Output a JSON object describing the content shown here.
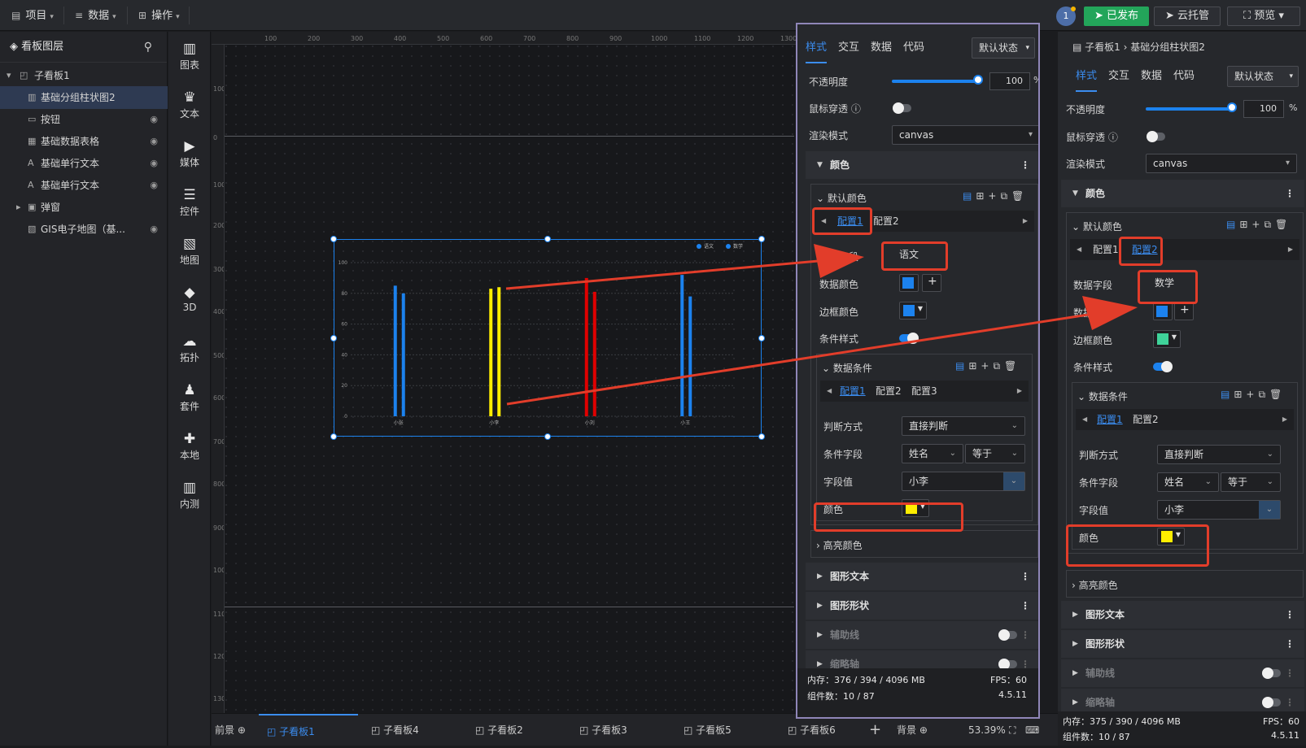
{
  "topbar": {
    "menu_project": "项目",
    "menu_data": "数据",
    "menu_ops": "操作",
    "avatar_count": "1",
    "publish_label": "已发布",
    "cloud_label": "云托管",
    "preview_label": "预览",
    "publish_color": "#23a55a"
  },
  "layers": {
    "title": "看板图层",
    "items": [
      {
        "label": "子看板1",
        "icon": "board-icon"
      },
      {
        "label": "基础分组柱状图2",
        "icon": "bar-chart-icon"
      },
      {
        "label": "按钮",
        "icon": "button-icon"
      },
      {
        "label": "基础数据表格",
        "icon": "table-icon"
      },
      {
        "label": "基础单行文本",
        "icon": "text-icon"
      },
      {
        "label": "基础单行文本",
        "icon": "text-icon"
      },
      {
        "label": "弹窗",
        "icon": "popup-icon"
      },
      {
        "label": "GIS电子地图（基...",
        "icon": "map-icon"
      }
    ]
  },
  "iconbar": {
    "items": [
      "图表",
      "文本",
      "媒体",
      "控件",
      "地图",
      "3D",
      "拓扑",
      "套件",
      "本地",
      "内测"
    ]
  },
  "ruler": {
    "h_ticks": [
      "100",
      "200",
      "300",
      "400",
      "500",
      "600",
      "700",
      "800",
      "900",
      "1000",
      "1100",
      "1200",
      "1300"
    ],
    "v_ticks": [
      "100",
      "0",
      "100",
      "200",
      "300",
      "400",
      "500",
      "600",
      "700",
      "800",
      "900",
      "1000",
      "1100",
      "1200",
      "1300"
    ]
  },
  "chart_data": {
    "type": "bar",
    "categories": [
      "小张",
      "小李",
      "小刘",
      "小王"
    ],
    "series": [
      {
        "name": "语文",
        "values": [
          85,
          83,
          90,
          92
        ],
        "color": "#1c82ee"
      },
      {
        "name": "数学",
        "values": [
          80,
          84,
          81,
          78
        ],
        "color": "#1c82ee"
      }
    ],
    "highlight": {
      "category": "小李",
      "color": "#ffee00"
    },
    "highlight2": {
      "category": "小刘",
      "color": "#e00000"
    },
    "ylim": [
      0,
      100
    ],
    "yticks": [
      "0",
      "20",
      "40",
      "60",
      "80",
      "100"
    ],
    "grid": true,
    "legend": "top-right"
  },
  "bottom": {
    "tabs": [
      "前景",
      "子看板1",
      "子看板4",
      "子看板2",
      "子看板3",
      "子看板5",
      "子看板6",
      "背景"
    ],
    "zoom": "53.39%"
  },
  "panel1": {
    "tabs": [
      "样式",
      "交互",
      "数据",
      "代码"
    ],
    "state": "默认状态",
    "opacity_label": "不透明度",
    "opacity_value": "100",
    "opacity_unit": "%",
    "mouse_label": "鼠标穿透",
    "render_label": "渲染模式",
    "render_value": "canvas",
    "color_section": "颜色",
    "default_color": "默认颜色",
    "cfg1": "配置1",
    "cfg2": "配置2",
    "field_label": "数据字段",
    "field_value": "语文",
    "data_color_label": "数据颜色",
    "border_color_label": "边框颜色",
    "cond_style_label": "条件样式",
    "data_cond": "数据条件",
    "cond_cfg1": "配置1",
    "cond_cfg2": "配置2",
    "cond_cfg3": "配置3",
    "judge_label": "判断方式",
    "judge_value": "直接判断",
    "cond_field_label": "条件字段",
    "cond_field_value": "姓名",
    "cond_op_value": "等于",
    "field_val_label": "字段值",
    "field_val_value": "小李",
    "color_label": "颜色",
    "highlight_color": "高亮颜色",
    "graph_text": "图形文本",
    "graph_shape": "图形形状",
    "aux_line": "辅助线",
    "thumb_axis": "缩略轴",
    "mem": "内存：376 / 394 / 4096 MB",
    "fps": "FPS：60",
    "comp": "组件数：10 / 87",
    "version": "4.5.11"
  },
  "panel2": {
    "breadcrumb": "子看板1 › 基础分组柱状图2",
    "tabs": [
      "样式",
      "交互",
      "数据",
      "代码"
    ],
    "state": "默认状态",
    "opacity_label": "不透明度",
    "opacity_value": "100",
    "opacity_unit": "%",
    "mouse_label": "鼠标穿透",
    "render_label": "渲染模式",
    "render_value": "canvas",
    "color_section": "颜色",
    "default_color": "默认颜色",
    "cfg1": "配置1",
    "cfg2": "配置2",
    "field_label": "数据字段",
    "field_value": "数学",
    "data_color_label": "数据颜色",
    "border_color_label": "边框颜色",
    "cond_style_label": "条件样式",
    "data_cond": "数据条件",
    "cond_cfg1": "配置1",
    "cond_cfg2": "配置2",
    "judge_label": "判断方式",
    "judge_value": "直接判断",
    "cond_field_label": "条件字段",
    "cond_field_value": "姓名",
    "cond_op_value": "等于",
    "field_val_label": "字段值",
    "field_val_value": "小李",
    "color_label": "颜色",
    "highlight_color": "高亮颜色",
    "graph_text": "图形文本",
    "graph_shape": "图形形状",
    "aux_line": "辅助线",
    "thumb_axis": "缩略轴",
    "mem": "内存：375 / 390 / 4096 MB",
    "fps": "FPS：60",
    "comp": "组件数：10 / 87",
    "version": "4.5.11"
  },
  "colors": {
    "accent": "#1c82ee",
    "yellow": "#ffee00",
    "green": "#3fd39a",
    "annot": "#e23d2a"
  }
}
